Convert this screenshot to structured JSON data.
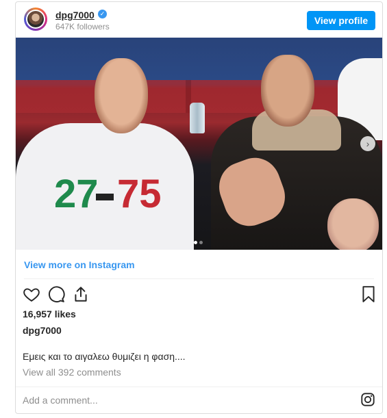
{
  "header": {
    "username": "dpg7000",
    "verified_glyph": "✓",
    "followers": "647K followers",
    "view_profile_label": "View profile"
  },
  "photo": {
    "shirt_number_left": "27",
    "shirt_number_right": "75",
    "carousel_dots": 2,
    "carousel_active_index": 0,
    "next_glyph": "›"
  },
  "post": {
    "view_more_label": "View more on Instagram",
    "likes": "16,957 likes",
    "owner": "dpg7000",
    "caption": "Εμεις και το αιγαλεω θυμιζει η φαση....",
    "view_comments": "View all 392 comments",
    "add_comment_placeholder": "Add a comment..."
  },
  "icons": {
    "like": "heart-icon",
    "comment": "comment-icon",
    "share": "share-icon",
    "save": "bookmark-icon",
    "brand": "instagram-icon"
  },
  "colors": {
    "accent": "#0095f6",
    "link": "#3897f0",
    "muted": "#8e8e8e",
    "border": "#dbdbdb"
  }
}
